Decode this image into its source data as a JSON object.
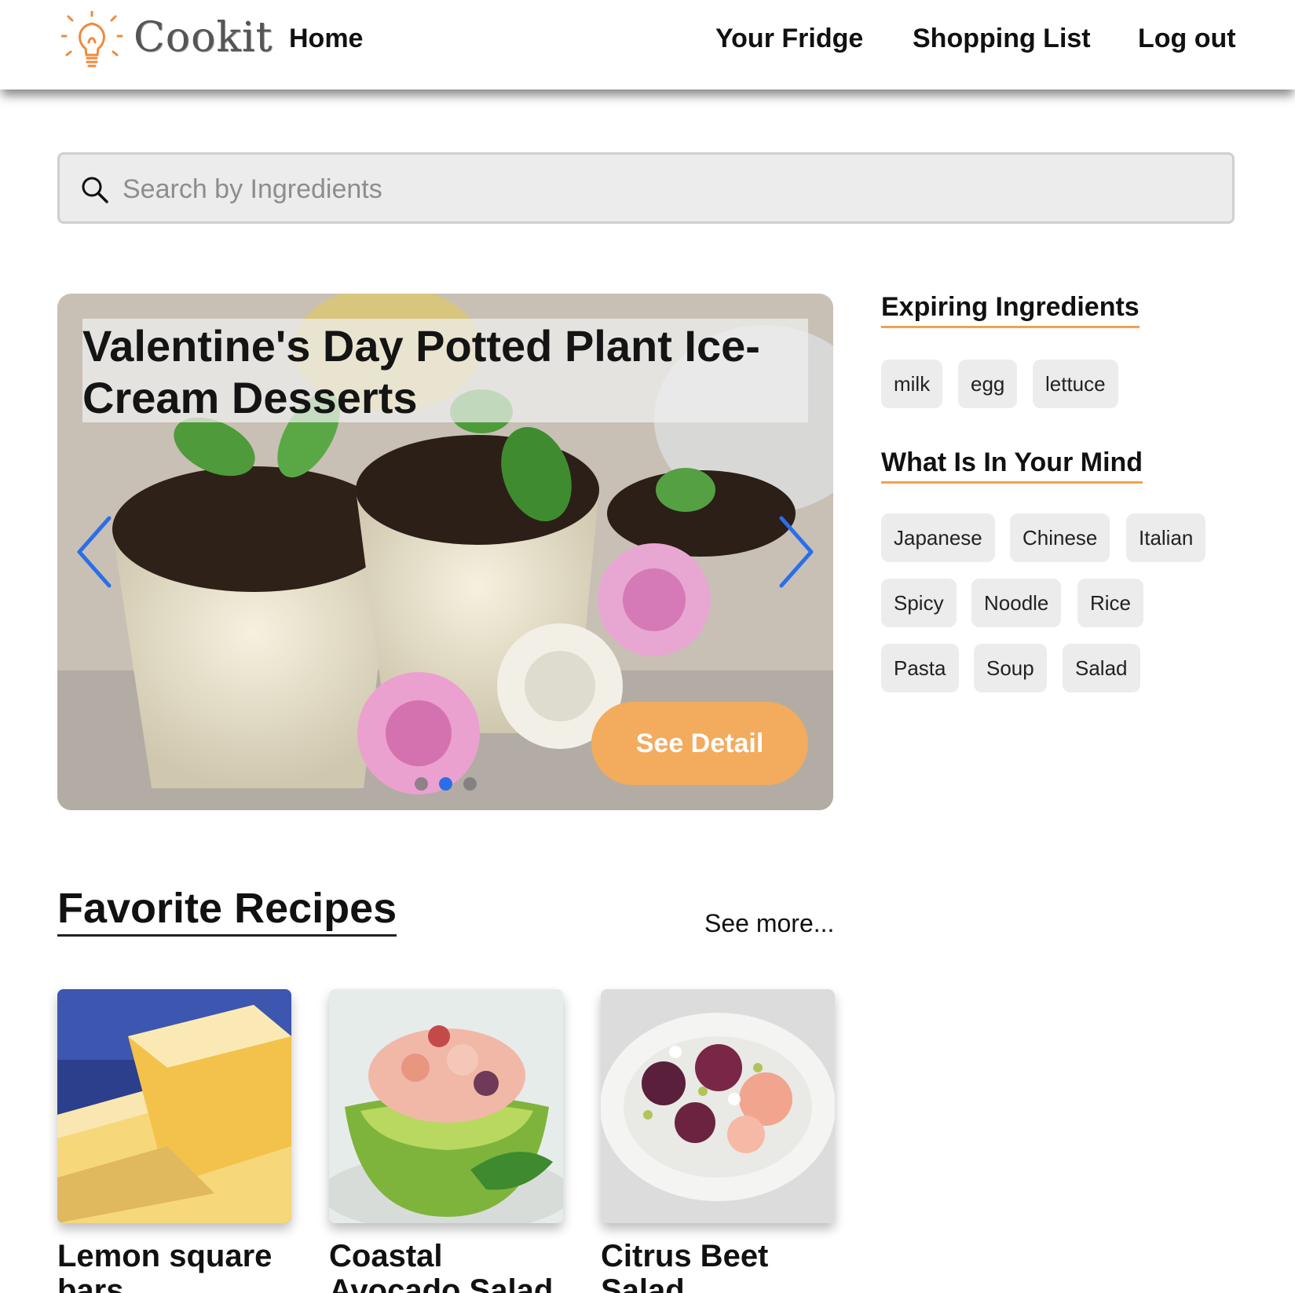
{
  "header": {
    "brand": "Cookit",
    "nav": {
      "home": "Home",
      "fridge": "Your Fridge",
      "shopping": "Shopping List",
      "logout": "Log out"
    }
  },
  "search": {
    "placeholder": "Search by Ingredients",
    "value": ""
  },
  "carousel": {
    "title": "Valentine's Day Potted Plant Ice-Cream Desserts",
    "button": "See Detail",
    "slides": 3,
    "active_slide": 2
  },
  "sidebar": {
    "expiring": {
      "title": "Expiring Ingredients",
      "items": [
        "milk",
        "egg",
        "lettuce"
      ]
    },
    "mind": {
      "title": "What Is In Your Mind",
      "items": [
        "Japanese",
        "Chinese",
        "Italian",
        "Spicy",
        "Noodle",
        "Rice",
        "Pasta",
        "Soup",
        "Salad"
      ]
    }
  },
  "favorites": {
    "title": "Favorite Recipes",
    "see_more": "See more...",
    "recipes": [
      {
        "name": "Lemon square bars"
      },
      {
        "name": "Coastal Avocado Salad"
      },
      {
        "name": "Citrus Beet Salad"
      }
    ]
  },
  "colors": {
    "accent": "#f3ab5e",
    "underline": "#f0a24e",
    "carousel_arrow": "#2a6fe8",
    "chip_bg": "#ececec"
  },
  "icons": [
    "lightbulb-logo-icon",
    "search-icon",
    "chevron-left-icon",
    "chevron-right-icon"
  ]
}
